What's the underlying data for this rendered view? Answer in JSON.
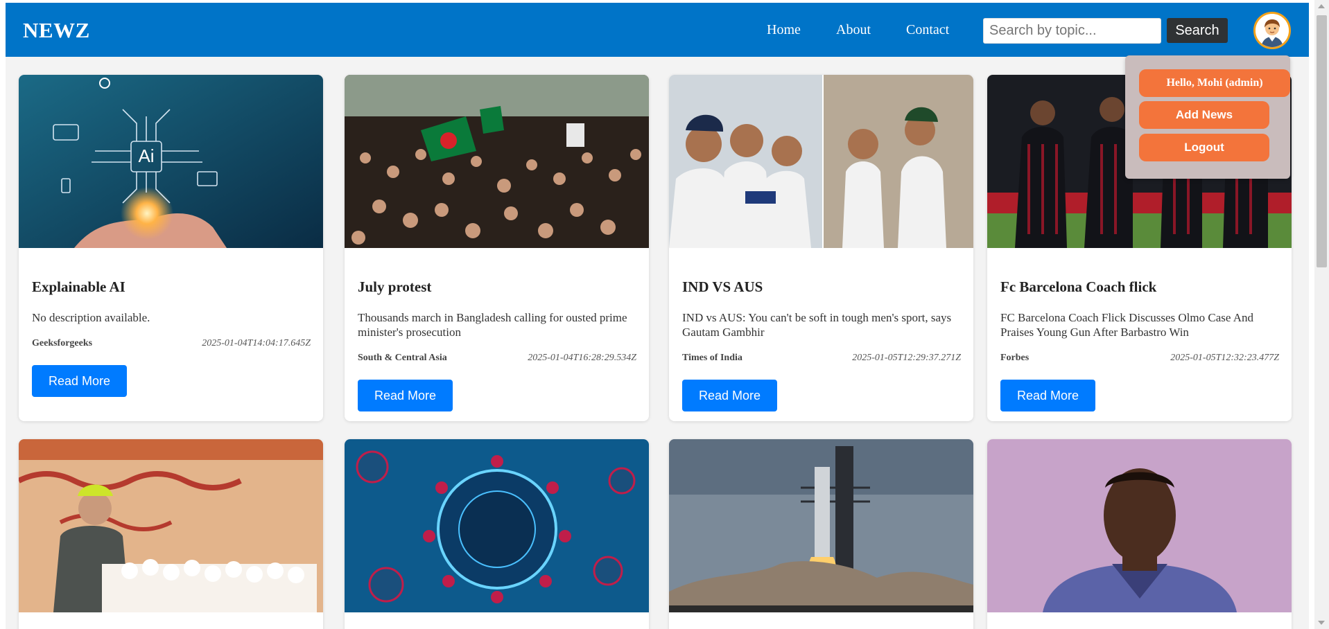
{
  "brand": "NEWZ",
  "nav": {
    "home": "Home",
    "about": "About",
    "contact": "Contact"
  },
  "search": {
    "placeholder": "Search by topic...",
    "value": "",
    "button": "Search"
  },
  "user_menu": {
    "greeting": "Hello, Mohi (admin)",
    "add_news": "Add News",
    "logout": "Logout"
  },
  "colors": {
    "navbar": "#0074c8",
    "accent_orange": "#f3743b",
    "read_more_blue": "#007bff",
    "dropdown_bg": "#c9bcbc"
  },
  "articles": [
    {
      "title": "Explainable AI",
      "description": "No description available.",
      "source": "Geeksforgeeks",
      "date": "2025-01-04T14:04:17.645Z",
      "button": "Read More",
      "image": "ai-chip-hand-image"
    },
    {
      "title": "July protest",
      "description": "Thousands march in Bangladesh calling for ousted prime minister's prosecution",
      "source": "South & Central Asia",
      "date": "2025-01-04T16:28:29.534Z",
      "button": "Read More",
      "image": "protest-crowd-image"
    },
    {
      "title": "IND VS AUS",
      "description": "IND vs AUS: You can't be soft in tough men's sport, says Gautam Gambhir",
      "source": "Times of India",
      "date": "2025-01-05T12:29:37.271Z",
      "button": "Read More",
      "image": "cricket-players-image"
    },
    {
      "title": "Fc Barcelona Coach flick",
      "description": "FC Barcelona Coach Flick Discusses Olmo Case And Praises Young Gun After Barbastro Win",
      "source": "Forbes",
      "date": "2025-01-05T12:32:23.477Z",
      "button": "Read More",
      "image": "football-team-image"
    },
    {
      "image": "speaker-podium-image"
    },
    {
      "image": "virus-image"
    },
    {
      "image": "rocket-launch-image"
    },
    {
      "image": "athlete-portrait-image"
    }
  ]
}
